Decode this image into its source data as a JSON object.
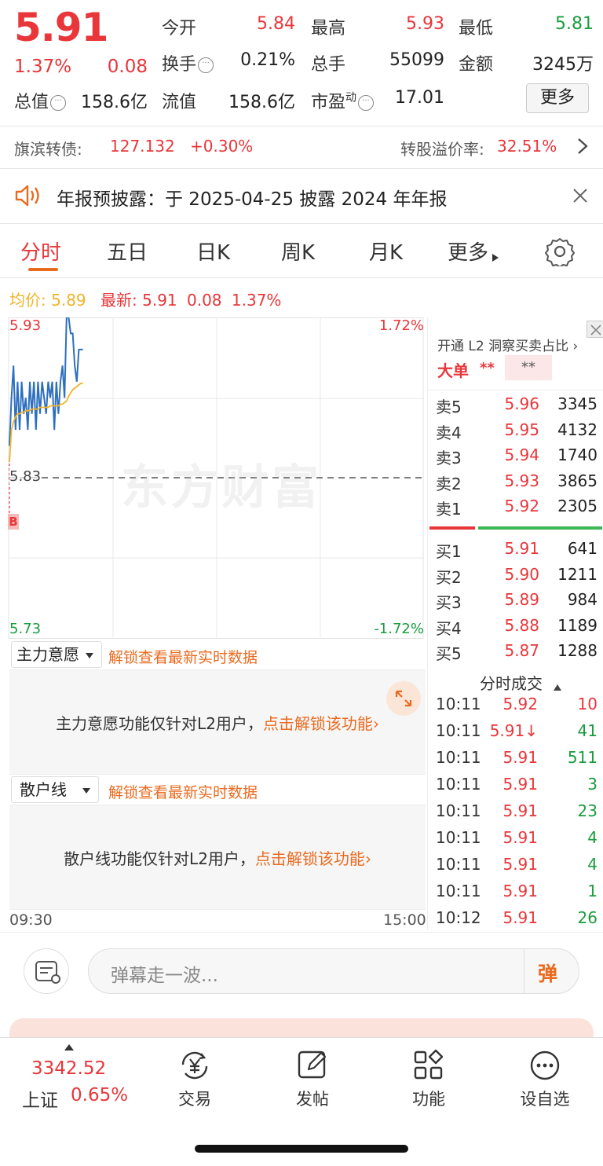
{
  "quote": {
    "price": "5.91",
    "change_pct": "1.37%",
    "change": "0.08",
    "open_label": "今开",
    "open": "5.84",
    "high_label": "最高",
    "high": "5.93",
    "low_label": "最低",
    "low": "5.81",
    "turnover_label": "换手",
    "turnover": "0.21%",
    "volume_label": "总手",
    "volume": "55099",
    "amount_label": "金额",
    "amount": "3245万",
    "mcap_label": "总值",
    "mcap": "158.6亿",
    "float_label": "流值",
    "float": "158.6亿",
    "pe_label": "市盈",
    "pe_sup": "动",
    "pe": "17.01",
    "more_button": "更多"
  },
  "bond": {
    "label": "旗滨转债:",
    "price": "127.132",
    "change": "+0.30%",
    "premium_label": "转股溢价率:",
    "premium": "32.51%"
  },
  "notice": {
    "text": "年报预披露：于 2025-04-25 披露 2024 年年报"
  },
  "tabs": [
    "分时",
    "五日",
    "日K",
    "周K",
    "月K",
    "更多"
  ],
  "legend": {
    "avg_label": "均价:",
    "avg": "5.89",
    "latest_label": "最新:",
    "latest": "5.91",
    "chg": "0.08",
    "pct": "1.37%"
  },
  "chart_axis": {
    "y_top": "5.93",
    "y_mid": "5.83",
    "y_bottom": "5.73",
    "pct_top": "1.72%",
    "pct_bottom": "-1.72%",
    "b_marker": "B",
    "watermark": "东方财富",
    "t_start": "09:30",
    "t_end": "15:00"
  },
  "chart_data": {
    "type": "line",
    "ylim": [
      5.73,
      5.93
    ],
    "prev_close": 5.83,
    "xlim_minutes": [
      0,
      240
    ],
    "series": [
      {
        "values": [
          5.85,
          5.88,
          5.9,
          5.86,
          5.89,
          5.86,
          5.89,
          5.87,
          5.88,
          5.86,
          5.89,
          5.87,
          5.89,
          5.86,
          5.89,
          5.87,
          5.89,
          5.88,
          5.87,
          5.89,
          5.88,
          5.89,
          5.86,
          5.89,
          5.87,
          5.89,
          5.9,
          5.88,
          5.93,
          5.93,
          5.92,
          5.92,
          5.9,
          5.89,
          5.91,
          5.91,
          5.91
        ]
      },
      {
        "values": [
          5.84,
          5.86,
          5.865,
          5.868,
          5.87,
          5.87,
          5.871,
          5.871,
          5.872,
          5.872,
          5.872,
          5.873,
          5.873,
          5.873,
          5.873,
          5.874,
          5.874,
          5.874,
          5.874,
          5.874,
          5.875,
          5.875,
          5.875,
          5.875,
          5.875,
          5.876,
          5.876,
          5.877,
          5.878,
          5.881,
          5.883,
          5.885,
          5.886,
          5.887,
          5.888,
          5.889,
          5.889
        ]
      }
    ]
  },
  "indicators": {
    "main_force": {
      "select": "主力意愿",
      "link": "解锁查看最新实时数据",
      "msg": "主力意愿功能仅针对L2用户，",
      "msg_link": "点击解锁该功能"
    },
    "retail": {
      "select": "散户线",
      "link": "解锁查看最新实时数据",
      "msg": "散户线功能仅针对L2用户，",
      "msg_link": "点击解锁该功能"
    }
  },
  "l2": {
    "title": "开通 L2 洞察买卖占比",
    "big_order": "大单",
    "stars1": "**",
    "stars2": "**"
  },
  "sell": [
    {
      "n": "卖5",
      "p": "5.96",
      "v": "3345"
    },
    {
      "n": "卖4",
      "p": "5.95",
      "v": "4132"
    },
    {
      "n": "卖3",
      "p": "5.94",
      "v": "1740"
    },
    {
      "n": "卖2",
      "p": "5.93",
      "v": "3865"
    },
    {
      "n": "卖1",
      "p": "5.92",
      "v": "2305"
    }
  ],
  "buy": [
    {
      "n": "买1",
      "p": "5.91",
      "v": "641"
    },
    {
      "n": "买2",
      "p": "5.90",
      "v": "1211"
    },
    {
      "n": "买3",
      "p": "5.89",
      "v": "984"
    },
    {
      "n": "买4",
      "p": "5.88",
      "v": "1189"
    },
    {
      "n": "买5",
      "p": "5.87",
      "v": "1288"
    }
  ],
  "trades_title": "分时成交",
  "trades": [
    {
      "t": "10:11",
      "p": "5.92",
      "v": "10",
      "pc": "red",
      "vc": "red"
    },
    {
      "t": "10:11",
      "p": "5.91↓",
      "v": "41",
      "pc": "red",
      "vc": "green"
    },
    {
      "t": "10:11",
      "p": "5.91",
      "v": "511",
      "pc": "red",
      "vc": "green"
    },
    {
      "t": "10:11",
      "p": "5.91",
      "v": "3",
      "pc": "red",
      "vc": "green"
    },
    {
      "t": "10:11",
      "p": "5.91",
      "v": "23",
      "pc": "red",
      "vc": "green"
    },
    {
      "t": "10:11",
      "p": "5.91",
      "v": "4",
      "pc": "red",
      "vc": "green"
    },
    {
      "t": "10:11",
      "p": "5.91",
      "v": "4",
      "pc": "red",
      "vc": "green"
    },
    {
      "t": "10:11",
      "p": "5.91",
      "v": "1",
      "pc": "red",
      "vc": "green"
    },
    {
      "t": "10:12",
      "p": "5.91",
      "v": "26",
      "pc": "red",
      "vc": "green"
    }
  ],
  "comment": {
    "placeholder": "弹幕走一波...",
    "danmu": "弹"
  },
  "index": {
    "value": "3342.52",
    "name": "上证",
    "pct": "0.65%"
  },
  "nav": [
    {
      "label": "交易",
      "icon": "yen-trade-icon"
    },
    {
      "label": "发帖",
      "icon": "edit-icon"
    },
    {
      "label": "功能",
      "icon": "grid-icon"
    },
    {
      "label": "设自选",
      "icon": "dots-icon"
    }
  ],
  "colors": {
    "up": "#e8363a",
    "down": "#1a9c3e",
    "accent": "#ea6a1e",
    "price_line": "#2e6fbf",
    "avg_line": "#f0b429"
  }
}
